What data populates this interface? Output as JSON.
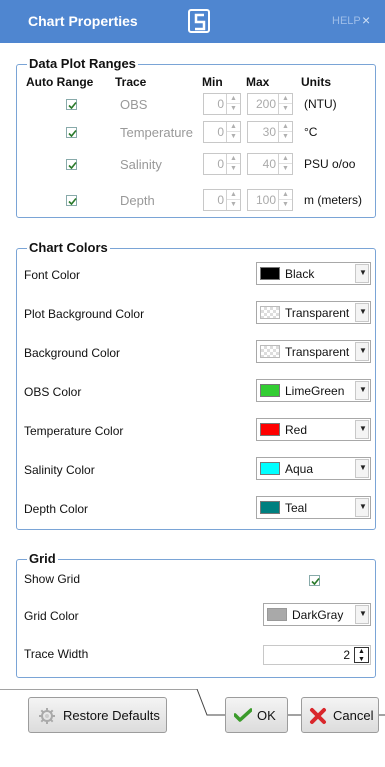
{
  "window": {
    "title": "Chart Properties",
    "help": "HELP",
    "close": "×",
    "logo_icon": "campbell-logo-icon"
  },
  "data_plot_ranges": {
    "title": "Data Plot Ranges",
    "headers": {
      "auto_range": "Auto Range",
      "trace": "Trace",
      "min": "Min",
      "max": "Max",
      "units": "Units"
    },
    "rows": [
      {
        "auto": true,
        "trace": "OBS",
        "min": "0",
        "max": "200",
        "units": "(NTU)"
      },
      {
        "auto": true,
        "trace": "Temperature",
        "min": "0",
        "max": "30",
        "units": "°C"
      },
      {
        "auto": true,
        "trace": "Salinity",
        "min": "0",
        "max": "40",
        "units": "PSU o/oo"
      },
      {
        "auto": true,
        "trace": "Depth",
        "min": "0",
        "max": "100",
        "units": "m (meters)"
      }
    ]
  },
  "chart_colors": {
    "title": "Chart Colors",
    "items": [
      {
        "label": "Font Color",
        "value": "Black",
        "swatch": "#000000"
      },
      {
        "label": "Plot Background Color",
        "value": "Transparent",
        "swatch": "transparent"
      },
      {
        "label": "Background Color",
        "value": "Transparent",
        "swatch": "transparent"
      },
      {
        "label": "OBS Color",
        "value": "LimeGreen",
        "swatch": "#32cd32"
      },
      {
        "label": "Temperature Color",
        "value": "Red",
        "swatch": "#ff0000"
      },
      {
        "label": "Salinity Color",
        "value": "Aqua",
        "swatch": "#00ffff"
      },
      {
        "label": "Depth Color",
        "value": "Teal",
        "swatch": "#008080"
      }
    ]
  },
  "grid": {
    "title": "Grid",
    "show_grid_label": "Show Grid",
    "show_grid": true,
    "grid_color_label": "Grid Color",
    "grid_color_value": "DarkGray",
    "grid_color_swatch": "#a9a9a9",
    "trace_width_label": "Trace Width",
    "trace_width_value": "2"
  },
  "footer": {
    "restore": "Restore Defaults",
    "ok": "OK",
    "cancel": "Cancel"
  }
}
